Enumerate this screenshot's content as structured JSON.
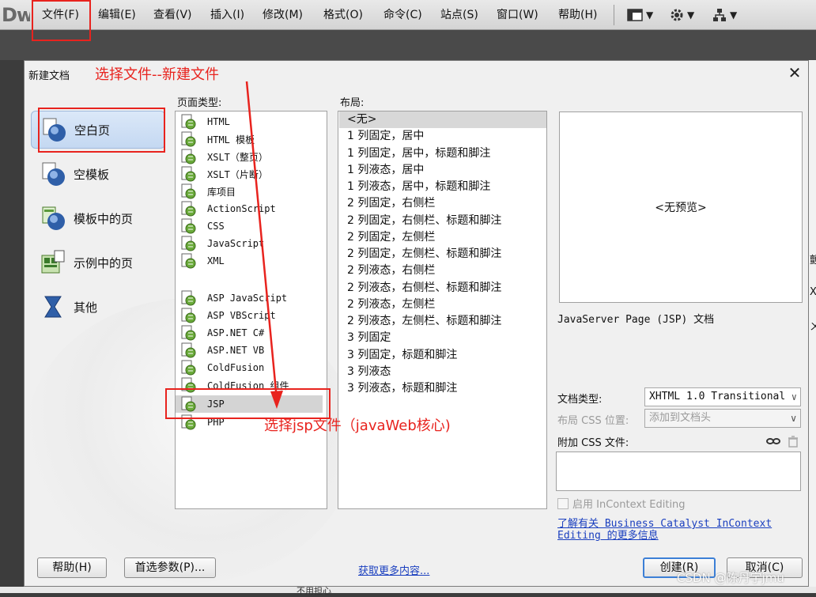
{
  "app": {
    "logo": "Dw",
    "menu": [
      "文件(F)",
      "编辑(E)",
      "查看(V)",
      "插入(I)",
      "修改(M)",
      "格式(O)",
      "命令(C)",
      "站点(S)",
      "窗口(W)",
      "帮助(H)"
    ],
    "tool_caret": "▼"
  },
  "dialog": {
    "title": "新建文档",
    "close": "✕",
    "categories": [
      "空白页",
      "空模板",
      "模板中的页",
      "示例中的页",
      "其他"
    ],
    "page_type_label": "页面类型:",
    "page_types": [
      "HTML",
      "HTML 模板",
      "XSLT（整页）",
      "XSLT（片断）",
      "库项目",
      "ActionScript",
      "CSS",
      "JavaScript",
      "XML",
      "ASP JavaScript",
      "ASP VBScript",
      "ASP.NET C#",
      "ASP.NET VB",
      "ColdFusion",
      "ColdFusion 组件",
      "JSP",
      "PHP"
    ],
    "selected_page_type": "JSP",
    "layout_label": "布局:",
    "layouts": [
      "<无>",
      "1 列固定，居中",
      "1 列固定，居中，标题和脚注",
      "1 列液态，居中",
      "1 列液态，居中，标题和脚注",
      "2 列固定，右侧栏",
      "2 列固定，右侧栏、标题和脚注",
      "2 列固定，左侧栏",
      "2 列固定，左侧栏、标题和脚注",
      "2 列液态，右侧栏",
      "2 列液态，右侧栏、标题和脚注",
      "2 列液态，左侧栏",
      "2 列液态，左侧栏、标题和脚注",
      "3 列固定",
      "3 列固定，标题和脚注",
      "3 列液态",
      "3 列液态，标题和脚注"
    ],
    "preview_text": "<无预览>",
    "description": "JavaServer Page (JSP) 文档",
    "doctype_label": "文档类型:",
    "doctype_value": "XHTML 1.0 Transitional",
    "layout_css_label": "布局 CSS 位置:",
    "layout_css_value": "添加到文档头",
    "attach_css_label": "附加 CSS 文件:",
    "incontext_label": "启用 InContext Editing",
    "learn_more_link": "了解有关 Business Catalyst InContext Editing 的更多信息",
    "help_button": "帮助(H)",
    "prefs_button": "首选参数(P)...",
    "more_content_link": "获取更多内容...",
    "create_button": "创建(R)",
    "cancel_button": "取消(C)"
  },
  "annotations": {
    "step1": "选择文件--新建文件",
    "step2": "选择jsp文件（javaWeb核心)",
    "color": "#e8231e"
  },
  "background": {
    "right_fragments": [
      "颤",
      "X",
      "ㄨ"
    ],
    "bottom_fragment": "不用担心"
  },
  "watermark": "CSDN @陈丹宇jmu"
}
